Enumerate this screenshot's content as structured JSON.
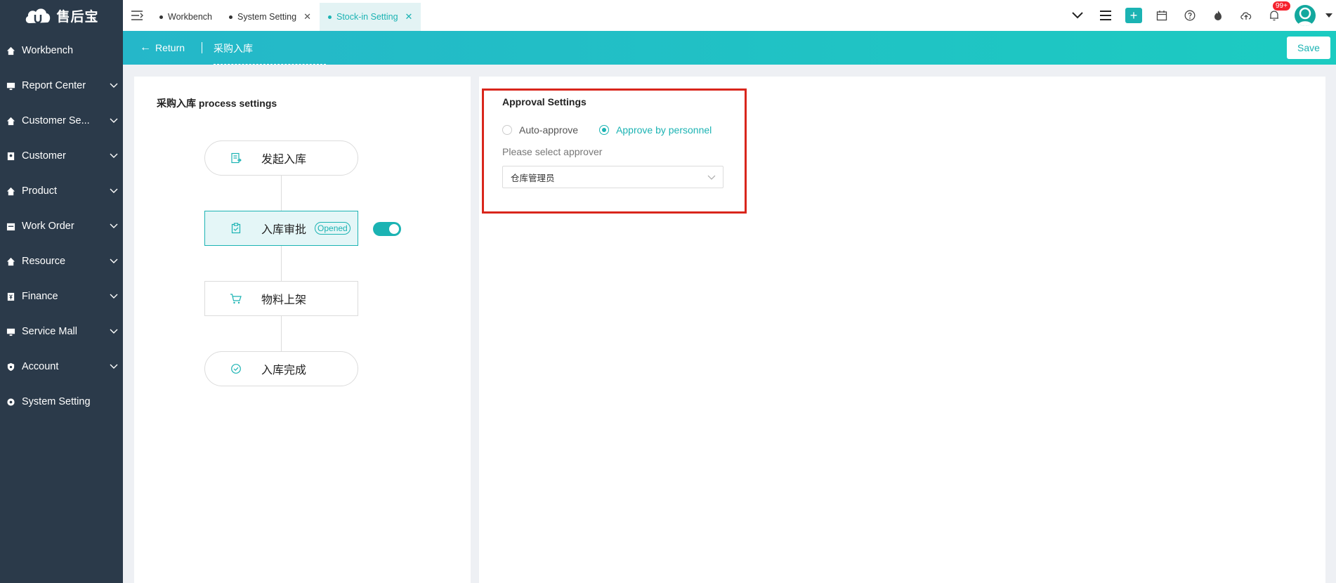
{
  "app": {
    "logo_text": "售后宝"
  },
  "sidebar": {
    "items": [
      {
        "label": "Workbench",
        "icon": "home-icon",
        "has_children": false
      },
      {
        "label": "Report Center",
        "icon": "monitor-icon",
        "has_children": true
      },
      {
        "label": "Customer Se...",
        "icon": "home-icon",
        "has_children": true
      },
      {
        "label": "Customer",
        "icon": "contact-card-icon",
        "has_children": true
      },
      {
        "label": "Product",
        "icon": "home-icon",
        "has_children": true
      },
      {
        "label": "Work Order",
        "icon": "calendar-icon",
        "has_children": true
      },
      {
        "label": "Resource",
        "icon": "home-icon",
        "has_children": true
      },
      {
        "label": "Finance",
        "icon": "finance-icon",
        "has_children": true
      },
      {
        "label": "Service Mall",
        "icon": "monitor-icon",
        "has_children": true
      },
      {
        "label": "Account",
        "icon": "shield-icon",
        "has_children": true
      },
      {
        "label": "System Setting",
        "icon": "gear-icon",
        "has_children": false
      }
    ]
  },
  "tabs": [
    {
      "label": "Workbench",
      "closable": false,
      "active": false
    },
    {
      "label": "System Setting",
      "closable": true,
      "active": false
    },
    {
      "label": "Stock-in Setting",
      "closable": true,
      "active": true
    }
  ],
  "topbar": {
    "notification_badge": "99+",
    "icons": [
      "chevron-down-icon",
      "list-icon",
      "plus-icon",
      "calendar-icon",
      "help-icon",
      "flame-icon",
      "cloud-upload-icon",
      "bell-icon",
      "user-avatar"
    ]
  },
  "subheader": {
    "return_label": "Return",
    "title": "采购入库",
    "save_label": "Save"
  },
  "process": {
    "title": "采购入库 process settings",
    "nodes": [
      {
        "label": "发起入库",
        "icon": "document-icon"
      },
      {
        "label": "入库审批",
        "icon": "clipboard-check-icon",
        "tag": "Opened",
        "toggle_on": true
      },
      {
        "label": "物料上架",
        "icon": "cart-icon"
      },
      {
        "label": "入库完成",
        "icon": "check-circle-icon"
      }
    ]
  },
  "approval": {
    "title": "Approval Settings",
    "options": [
      {
        "label": "Auto-approve",
        "checked": false
      },
      {
        "label": "Approve by personnel",
        "checked": true
      }
    ],
    "approver_label": "Please select approver",
    "approver_value": "仓库管理员"
  },
  "colors": {
    "sidebar_bg": "#2b3a4a",
    "accent": "#1bb3b3",
    "highlight_border": "#d9261c",
    "badge": "#f5222d"
  }
}
